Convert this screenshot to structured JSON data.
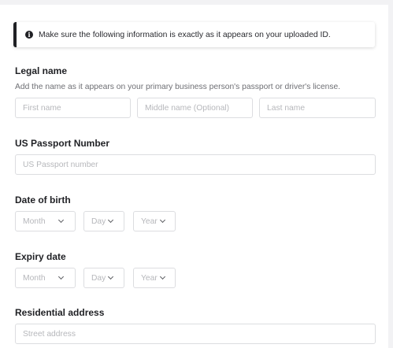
{
  "notice": {
    "icon": "info-icon",
    "text": "Make sure the following information is exactly as it appears on your uploaded ID."
  },
  "legal_name": {
    "heading": "Legal name",
    "hint": "Add the name as it appears on your primary business person's passport or driver's license.",
    "first_placeholder": "First name",
    "middle_placeholder": "Middle name (Optional)",
    "last_placeholder": "Last name"
  },
  "passport": {
    "heading": "US Passport Number",
    "placeholder": "US Passport number"
  },
  "dob": {
    "heading": "Date of birth",
    "month": "Month",
    "day": "Day",
    "year": "Year"
  },
  "expiry": {
    "heading": "Expiry date",
    "month": "Month",
    "day": "Day",
    "year": "Year"
  },
  "address": {
    "heading": "Residential address",
    "street_placeholder": "Street address"
  }
}
